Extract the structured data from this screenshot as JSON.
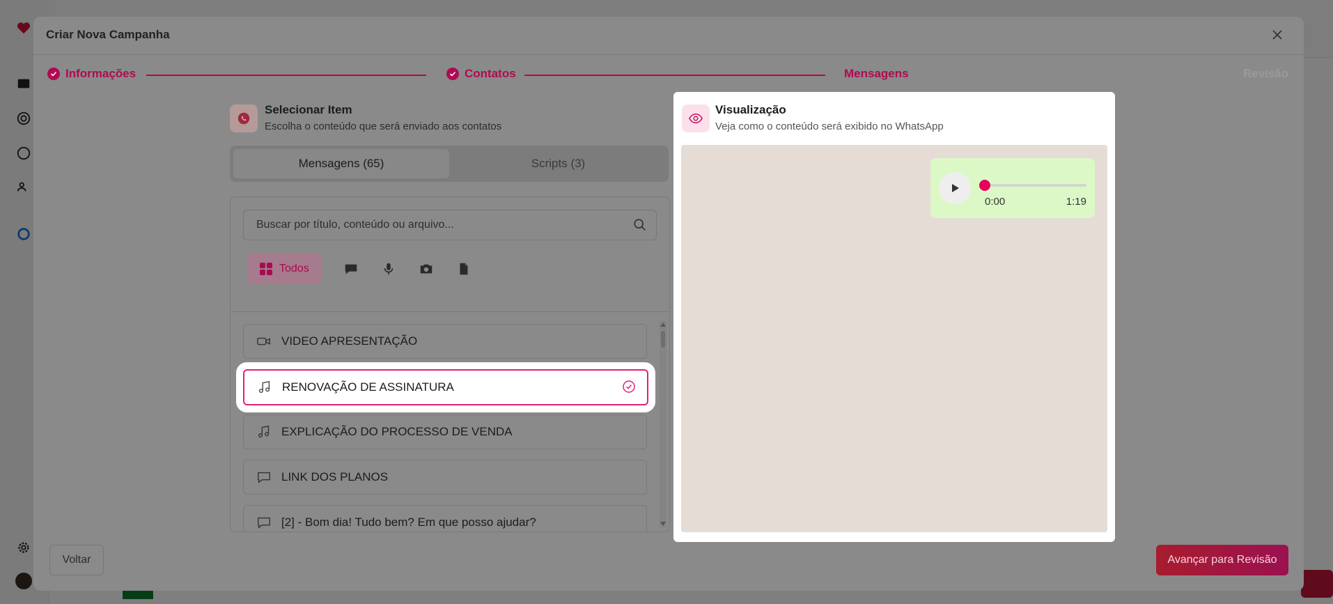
{
  "modal": {
    "title": "Criar Nova Campanha"
  },
  "stepper": {
    "steps": [
      {
        "label": "Informações",
        "state": "done"
      },
      {
        "label": "Contatos",
        "state": "done"
      },
      {
        "label": "Mensagens",
        "state": "active"
      },
      {
        "label": "Revisão",
        "state": "pending"
      }
    ]
  },
  "select_item": {
    "title": "Selecionar Item",
    "subtitle": "Escolha o conteúdo que será enviado aos contatos",
    "tabs": [
      {
        "label": "Mensagens (65)",
        "active": true
      },
      {
        "label": "Scripts (3)",
        "active": false
      }
    ],
    "search_placeholder": "Buscar por título, conteúdo ou arquivo...",
    "filters": {
      "active_label": "Todos",
      "icons": [
        "chat-icon",
        "microphone-icon",
        "camera-icon",
        "file-icon"
      ]
    },
    "items": [
      {
        "label": "VIDEO APRESENTAÇÃO",
        "icon": "video-icon",
        "selected": false
      },
      {
        "label": "RENOVAÇÃO DE ASSINATURA",
        "icon": "music-note-icon",
        "selected": true
      },
      {
        "label": "EXPLICAÇÃO DO PROCESSO DE VENDA",
        "icon": "music-note-icon",
        "selected": false
      },
      {
        "label": "LINK DOS PLANOS",
        "icon": "chat-icon",
        "selected": false
      },
      {
        "label": "[2] - Bom dia! Tudo bem? Em que posso ajudar?",
        "icon": "chat-icon",
        "selected": false
      }
    ]
  },
  "preview": {
    "title": "Visualização",
    "subtitle": "Veja como o conteúdo será exibido no WhatsApp",
    "audio": {
      "current_time": "0:00",
      "duration": "1:19",
      "progress": 0
    }
  },
  "footer": {
    "back_label": "Voltar",
    "next_label": "Avançar para Revisão"
  },
  "colors": {
    "accent": "#b00a52",
    "selection_border": "#e0207a",
    "audio_bubble": "#dcf8c6",
    "chat_background": "#e5ddd5"
  }
}
